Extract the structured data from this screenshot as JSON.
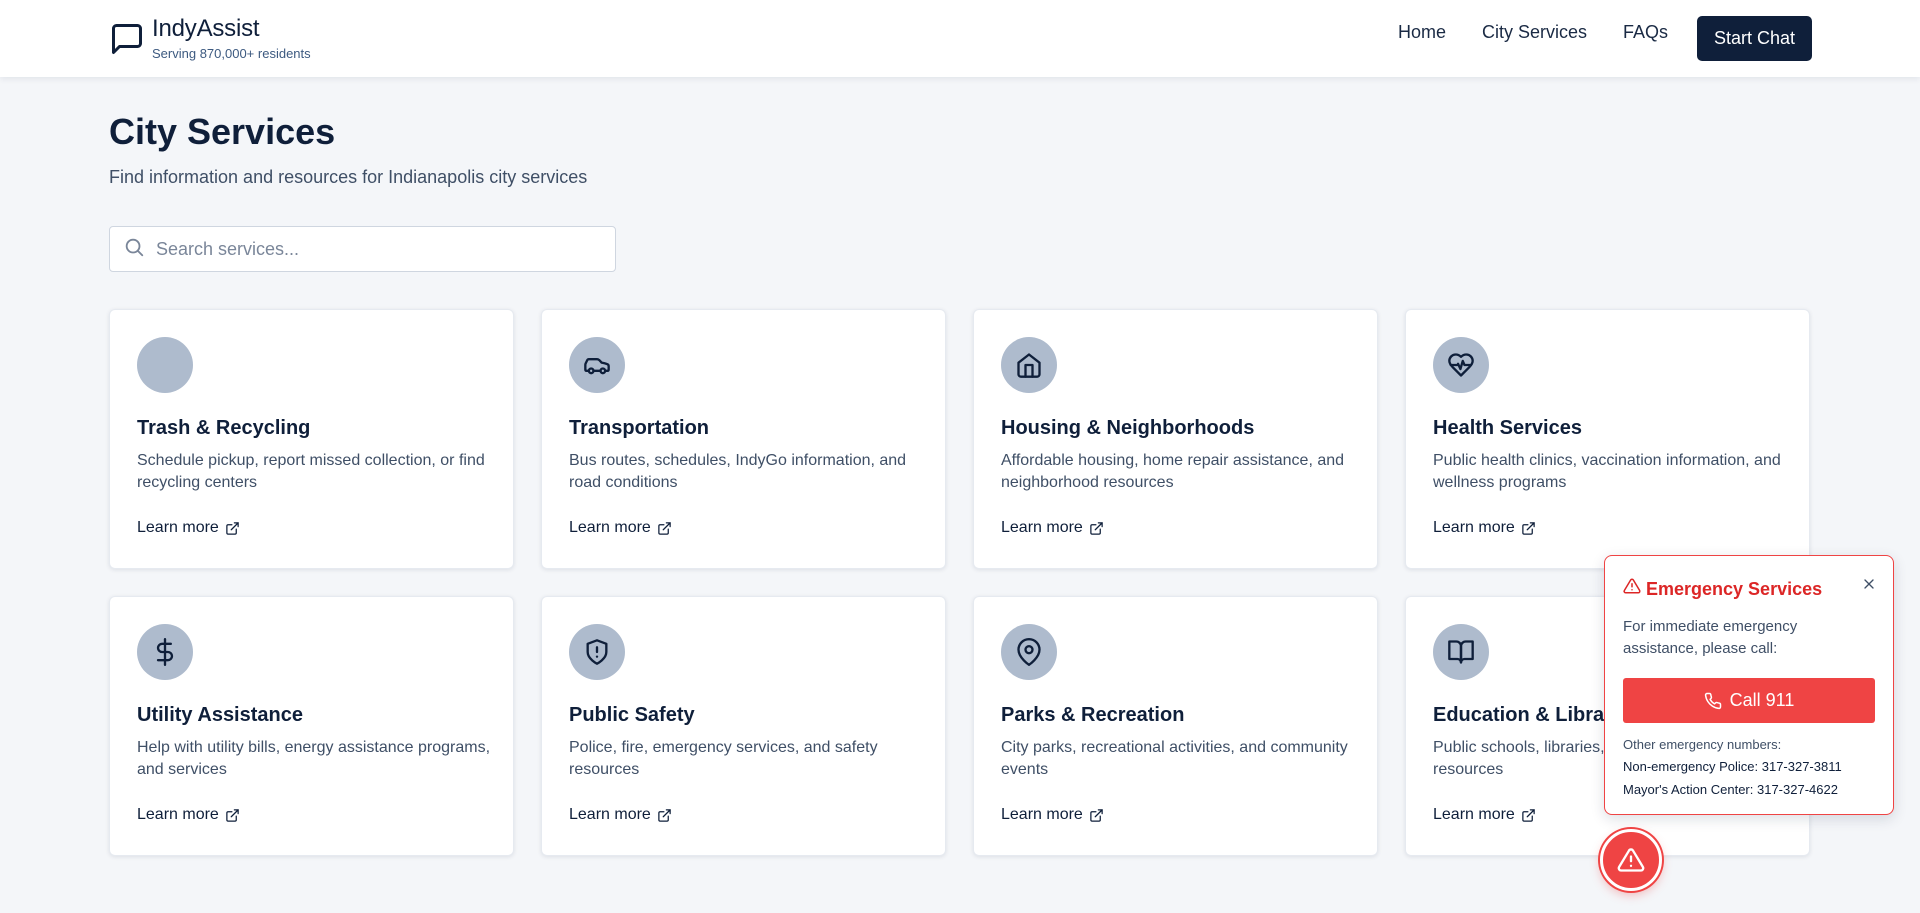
{
  "header": {
    "brand_name": "IndyAssist",
    "tagline": "Serving 870,000+ residents",
    "nav": [
      {
        "label": "Home"
      },
      {
        "label": "City Services"
      },
      {
        "label": "FAQs"
      }
    ],
    "cta_label": "Start Chat"
  },
  "page": {
    "title": "City Services",
    "subtitle": "Find information and resources for Indianapolis city services"
  },
  "search": {
    "placeholder": "Search services...",
    "value": ""
  },
  "services": [
    {
      "title": "Trash & Recycling",
      "description": "Schedule pickup, report missed collection, or find recycling centers",
      "link_label": "Learn more",
      "icon": "blank-icon"
    },
    {
      "title": "Transportation",
      "description": "Bus routes, schedules, IndyGo information, and road conditions",
      "link_label": "Learn more",
      "icon": "car-icon"
    },
    {
      "title": "Housing & Neighborhoods",
      "description": "Affordable housing, home repair assistance, and neighborhood resources",
      "link_label": "Learn more",
      "icon": "home-icon"
    },
    {
      "title": "Health Services",
      "description": "Public health clinics, vaccination information, and wellness programs",
      "link_label": "Learn more",
      "icon": "heart-pulse-icon"
    },
    {
      "title": "Utility Assistance",
      "description": "Help with utility bills, energy assistance programs, and services",
      "link_label": "Learn more",
      "icon": "dollar-icon"
    },
    {
      "title": "Public Safety",
      "description": "Police, fire, emergency services, and safety resources",
      "link_label": "Learn more",
      "icon": "shield-alert-icon"
    },
    {
      "title": "Parks & Recreation",
      "description": "City parks, recreational activities, and community events",
      "link_label": "Learn more",
      "icon": "map-pin-icon"
    },
    {
      "title": "Education & Libraries",
      "description": "Public schools, libraries, and educational resources",
      "link_label": "Learn more",
      "icon": "book-open-icon"
    }
  ],
  "emergency": {
    "title": "Emergency Services",
    "description": "For immediate emergency assistance, please call:",
    "call_label": "Call 911",
    "other_label": "Other emergency numbers:",
    "numbers": [
      "Non-emergency Police: 317-327-3811",
      "Mayor's Action Center: 317-327-4622"
    ]
  },
  "colors": {
    "navy": "#0f1f3a",
    "icon_circle": "#aebbcd",
    "emergency_red": "#ef4444",
    "emergency_title": "#dc2626",
    "page_bg": "#f4f6f9"
  }
}
